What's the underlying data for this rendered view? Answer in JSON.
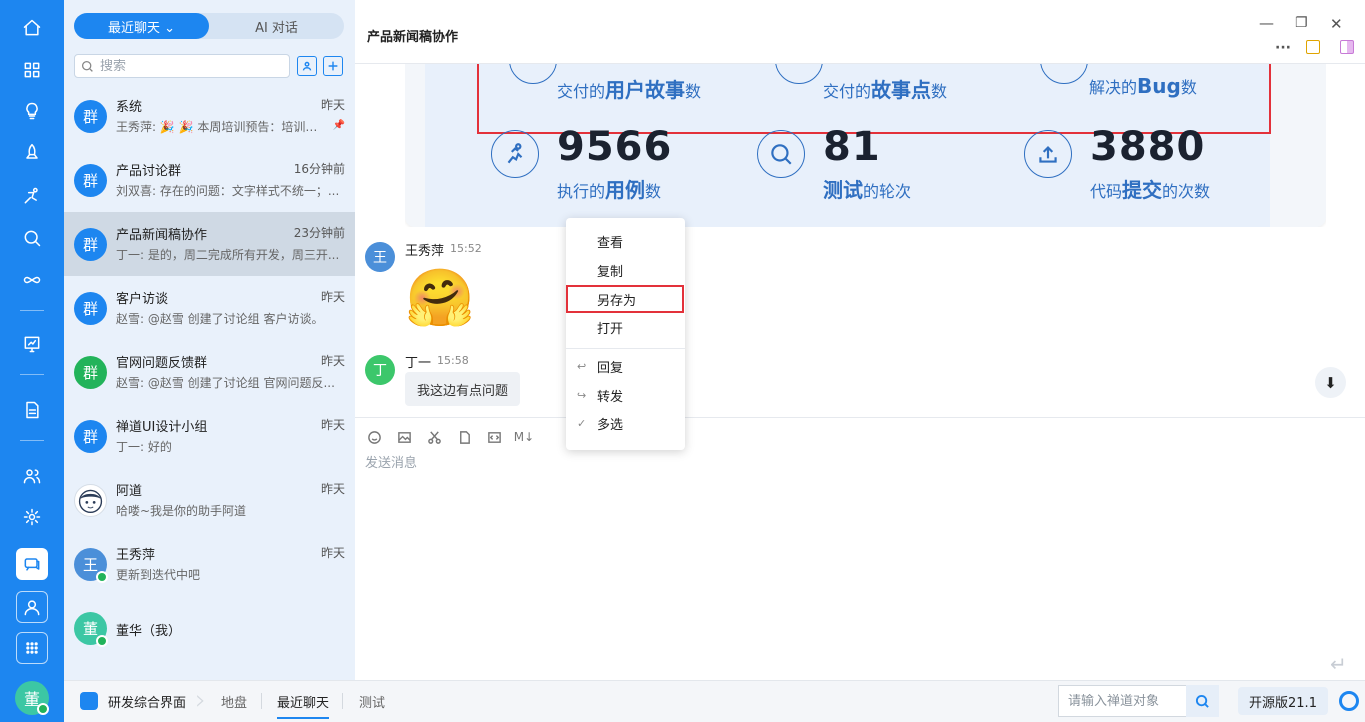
{
  "window": {
    "title": "产品新闻稿协作",
    "minimize_glyph": "—",
    "restore_glyph": "❐",
    "close_glyph": "✕",
    "more_glyph": "···"
  },
  "sidebar": {
    "segments": [
      "最近聊天 ⌄",
      "AI 对话"
    ],
    "search_placeholder": "搜索",
    "chats": [
      {
        "name": "系统",
        "time": "昨天",
        "preview": "王秀萍: 🎉 🎉 本周培训预告：培训主...",
        "avatar": "群",
        "pinned": true
      },
      {
        "name": "产品讨论群",
        "time": "16分钟前",
        "preview": "刘双喜: 存在的问题：文字样式不统一；...",
        "avatar": "群"
      },
      {
        "name": "产品新闻稿协作",
        "time": "23分钟前",
        "preview": "丁一: 是的，周二完成所有开发，周三开...",
        "avatar": "群",
        "selected": true
      },
      {
        "name": "客户访谈",
        "time": "昨天",
        "preview": "赵雪: @赵雪 创建了讨论组 客户访谈。",
        "avatar": "群"
      },
      {
        "name": "官网问题反馈群",
        "time": "昨天",
        "preview": "赵雪: @赵雪 创建了讨论组 官网问题反...",
        "avatar": "群"
      },
      {
        "name": "禅道UI设计小组",
        "time": "昨天",
        "preview": "丁一: 好的",
        "avatar": "群"
      },
      {
        "name": "阿道",
        "time": "昨天",
        "preview": "哈喽~我是你的助手阿道",
        "avatar": ""
      },
      {
        "name": "王秀萍",
        "time": "昨天",
        "preview": "更新到迭代中吧",
        "avatar": "王"
      },
      {
        "name": "董华（我）",
        "time": "",
        "preview": "",
        "avatar": "董"
      }
    ]
  },
  "image_card": {
    "top_captions": [
      {
        "pre": "交付的",
        "bold": "用户故事",
        "post": "数"
      },
      {
        "pre": "交付的",
        "bold": "故事点",
        "post": "数"
      },
      {
        "pre": "解决的",
        "bold": "Bug",
        "post": "数"
      }
    ],
    "stats": [
      {
        "value": "9566",
        "pre": "执行的",
        "bold": "用例",
        "post": "数",
        "icon": "runner-icon"
      },
      {
        "value": "81",
        "pre": "",
        "bold": "测试",
        "post": "的轮次",
        "icon": "magnifier-icon"
      },
      {
        "value": "3880",
        "pre": "代码",
        "bold": "提交",
        "post": "的次数",
        "icon": "upload-icon"
      }
    ]
  },
  "messages": [
    {
      "sender": "王秀萍",
      "time": "15:52",
      "avatar": "王",
      "content": "🤗"
    },
    {
      "sender": "丁一",
      "time": "15:58",
      "avatar": "丁",
      "content": "我这边有点问题"
    }
  ],
  "composer": {
    "placeholder": "发送消息",
    "markdown_label": "M↓"
  },
  "context_menu": {
    "items": [
      "查看",
      "复制",
      "另存为",
      "打开",
      "回复",
      "转发",
      "多选"
    ],
    "highlighted": "另存为"
  },
  "status_bar": {
    "app_name": "研发综合界面",
    "tabs": [
      "地盘",
      "最近聊天",
      "测试"
    ],
    "active_tab": "最近聊天",
    "search_placeholder": "请输入禅道对象",
    "version": "开源版21.1"
  },
  "colors": {
    "brand": "#1d86f0",
    "highlight_red": "#e3313a",
    "online": "#22b35a"
  }
}
